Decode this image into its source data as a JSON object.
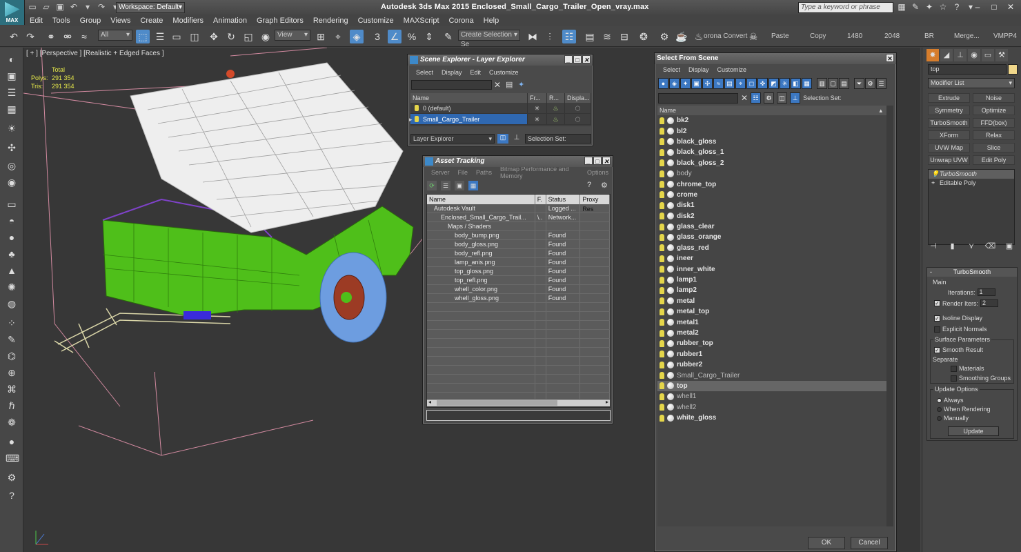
{
  "titlebar": {
    "app_title": "Autodesk 3ds Max  2015    Enclosed_Small_Cargo_Trailer_Open_vray.max",
    "workspace": "Workspace: Default",
    "search_placeholder": "Type a keyword or phrase",
    "logo_text": "MAX"
  },
  "menu": [
    "Edit",
    "Tools",
    "Group",
    "Views",
    "Create",
    "Modifiers",
    "Animation",
    "Graph Editors",
    "Rendering",
    "Customize",
    "MAXScript",
    "Corona",
    "Help"
  ],
  "toolbar": {
    "selection_filter": "All",
    "ref_coord": "View",
    "named_selection": "Create Selection Se",
    "texts": [
      "orona Convert",
      "Paste",
      "Copy",
      "1480",
      "2048",
      "BR",
      "Merge...",
      "VMPP4"
    ]
  },
  "viewport": {
    "label": "[ + ] [Perspective ] [Realistic + Edged Faces ]",
    "stats_header": "Total",
    "polys_label": "Polys:",
    "polys_value": "291 354",
    "tris_label": "Tris:",
    "tris_value": "291 354"
  },
  "scene_explorer": {
    "title": "Scene Explorer - Layer Explorer",
    "menu": [
      "Select",
      "Display",
      "Edit",
      "Customize"
    ],
    "columns": [
      "Name",
      "Fr...",
      "R...",
      "Displa..."
    ],
    "rows": [
      {
        "name": "0 (default)",
        "selected": false
      },
      {
        "name": "Small_Cargo_Trailer",
        "selected": true
      }
    ],
    "footer_dropdown": "Layer Explorer",
    "selection_set_label": "Selection Set:"
  },
  "asset_tracking": {
    "title": "Asset Tracking",
    "menu": [
      "Server",
      "File",
      "Paths",
      "Bitmap Performance and Memory",
      "Options"
    ],
    "columns": [
      "Name",
      "F.",
      "Status",
      "Proxy Res"
    ],
    "rows": [
      {
        "name": "Autodesk Vault",
        "f": "",
        "status": "Logged ...",
        "indent": 1
      },
      {
        "name": "Enclosed_Small_Cargo_Trail...",
        "f": "\\..",
        "status": "Network...",
        "indent": 2
      },
      {
        "name": "Maps / Shaders",
        "f": "",
        "status": "",
        "indent": 3
      },
      {
        "name": "body_bump.png",
        "f": "",
        "status": "Found",
        "indent": 4
      },
      {
        "name": "body_gloss.png",
        "f": "",
        "status": "Found",
        "indent": 4
      },
      {
        "name": "body_refl.png",
        "f": "",
        "status": "Found",
        "indent": 4
      },
      {
        "name": "lamp_anis.png",
        "f": "",
        "status": "Found",
        "indent": 4
      },
      {
        "name": "top_gloss.png",
        "f": "",
        "status": "Found",
        "indent": 4
      },
      {
        "name": "top_refl.png",
        "f": "",
        "status": "Found",
        "indent": 4
      },
      {
        "name": "whell_color.png",
        "f": "",
        "status": "Found",
        "indent": 4
      },
      {
        "name": "whell_gloss.png",
        "f": "",
        "status": "Found",
        "indent": 4
      }
    ]
  },
  "select_scene": {
    "title": "Select From Scene",
    "menu": [
      "Select",
      "Display",
      "Customize"
    ],
    "selection_set_label": "Selection Set:",
    "name_header": "Name",
    "items": [
      {
        "name": "bk2",
        "style": "bold"
      },
      {
        "name": "bl2",
        "style": "bold"
      },
      {
        "name": "black_gloss",
        "style": "bold"
      },
      {
        "name": "black_gloss_1",
        "style": "bold"
      },
      {
        "name": "black_gloss_2",
        "style": "bold"
      },
      {
        "name": "body",
        "style": "dim"
      },
      {
        "name": "chrome_top",
        "style": "bold"
      },
      {
        "name": "crome",
        "style": "bold"
      },
      {
        "name": "disk1",
        "style": "bold"
      },
      {
        "name": "disk2",
        "style": "bold"
      },
      {
        "name": "glass_clear",
        "style": "bold"
      },
      {
        "name": "glass_orange",
        "style": "bold"
      },
      {
        "name": "glass_red",
        "style": "bold"
      },
      {
        "name": "ineer",
        "style": "bold"
      },
      {
        "name": "inner_white",
        "style": "bold"
      },
      {
        "name": "lamp1",
        "style": "bold"
      },
      {
        "name": "lamp2",
        "style": "bold"
      },
      {
        "name": "metal",
        "style": "bold"
      },
      {
        "name": "metal_top",
        "style": "bold"
      },
      {
        "name": "metal1",
        "style": "bold"
      },
      {
        "name": "metal2",
        "style": "bold"
      },
      {
        "name": "rubber_top",
        "style": "bold"
      },
      {
        "name": "rubber1",
        "style": "bold"
      },
      {
        "name": "rubber2",
        "style": "bold"
      },
      {
        "name": "Small_Cargo_Trailer",
        "style": "dim"
      },
      {
        "name": "top",
        "style": "sel"
      },
      {
        "name": "whell1",
        "style": "dim"
      },
      {
        "name": "whell2",
        "style": "dim"
      },
      {
        "name": "white_gloss",
        "style": "bold"
      }
    ],
    "ok_label": "OK",
    "cancel_label": "Cancel"
  },
  "command_panel": {
    "object_name": "top",
    "modifier_list": "Modifier List",
    "modifier_buttons": [
      "Extrude",
      "Noise",
      "Symmetry",
      "Optimize",
      "TurboSmooth",
      "FFD(box)",
      "XForm",
      "Relax",
      "UVW Map",
      "Slice",
      "Unwrap UVW",
      "Edit Poly"
    ],
    "stack": [
      "TurboSmooth",
      "Editable Poly"
    ],
    "rollout_title": "TurboSmooth",
    "main_label": "Main",
    "iterations_label": "Iterations:",
    "iterations_value": "1",
    "render_iters_label": "Render Iters:",
    "render_iters_value": "2",
    "isoline_label": "Isoline Display",
    "explicit_normals_label": "Explicit Normals",
    "surface_params_label": "Surface Parameters",
    "smooth_result_label": "Smooth Result",
    "separate_label": "Separate",
    "materials_label": "Materials",
    "smoothing_groups_label": "Smoothing Groups",
    "update_options_label": "Update Options",
    "always_label": "Always",
    "when_rendering_label": "When Rendering",
    "manually_label": "Manually",
    "update_button": "Update"
  },
  "colors": {
    "accent_blue": "#2f68b1",
    "body_green": "#4fbf1a",
    "wheel_blue": "#6d9de0",
    "rim_red": "#9c3b24",
    "wire_white": "#e8e8e8",
    "stats_yellow": "#e6e94a",
    "cmd_tab_orange": "#d67d2c"
  }
}
